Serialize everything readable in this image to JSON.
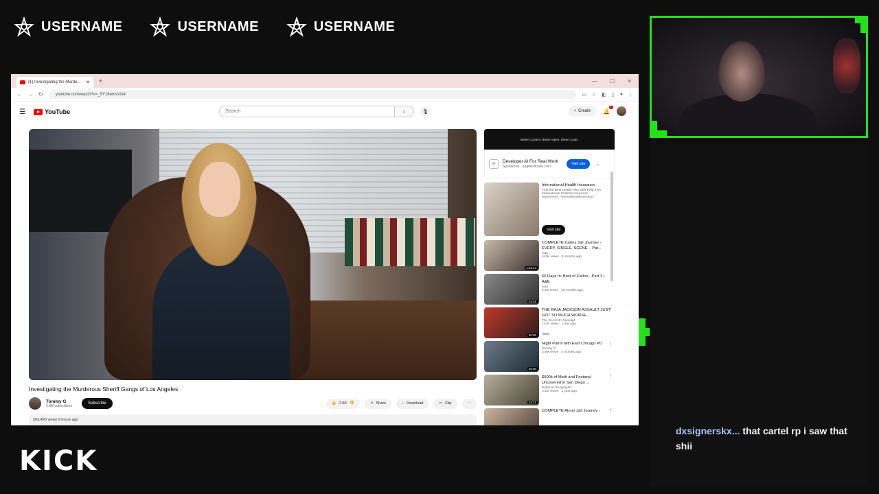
{
  "socials": [
    {
      "name": "USERNAME"
    },
    {
      "name": "USERNAME"
    },
    {
      "name": "USERNAME"
    }
  ],
  "browser": {
    "tab_title": "(1) Investigating the Murde...",
    "url": "youtube.com/watch?v=_9Y18emsVO4"
  },
  "youtube": {
    "logo": "YouTube",
    "search_placeholder": "Search",
    "create_label": "Create",
    "notifications": "1",
    "video": {
      "title": "Investigating the Murderous Sheriff Gangs of Los Angeles",
      "channel": "Tommy G",
      "subscribers": "2.8M subscribers",
      "subscribe_label": "Subscribe",
      "likes": "7.6K",
      "share_label": "Share",
      "download_label": "Download",
      "clip_label": "Clip",
      "views_time": "263,495 views  9 hours ago"
    },
    "ad": {
      "banner": "Better Content. Better Agent. Better Code.",
      "title": "Developer AI For Real Work",
      "sponsor": "Sponsored · augmentcode.com",
      "visit_label": "Visit site"
    },
    "recommendations": [
      {
        "title": "International Health Insurance",
        "channel": "Find the Best Health Plan with Help from International Citizens Insurance",
        "views": "Sponsored · internationalinsurance...",
        "duration": "",
        "visit": "Visit site",
        "thumb_colors": [
          "#d9d2c8",
          "#8a7a6a"
        ]
      },
      {
        "title": "COMPLETE Carlos Jail Journey - EVERY. SINGLE. SCENE. - Par...",
        "channel": "A&E",
        "views": "443K views · 5 months ago",
        "duration": "1:24:44",
        "thumb_colors": [
          "#c8b9a8",
          "#3d3331"
        ]
      },
      {
        "title": "60 Days In: Best of Carlos - Part 1 | A&E",
        "channel": "A&E",
        "views": "2.4M views · 10 months ago",
        "duration": "34:48",
        "thumb_colors": [
          "#8a8a8a",
          "#2f2f2f"
        ]
      },
      {
        "title": "THE RAJA JACKSON ASSAULT JUST GOT SO MUCH WORSE...",
        "channel": "The W.A.D.E. Concept",
        "views": "127K views · 1 day ago",
        "badge": "New",
        "duration": "35:00",
        "thumb_colors": [
          "#c0392b",
          "#2b1d1d"
        ]
      },
      {
        "title": "Night Patrol with East Chicago PD",
        "channel": "Tommy G",
        "views": "3.9M views · 3 months ago",
        "duration": "35:00",
        "thumb_colors": [
          "#6b7b88",
          "#1e2a33"
        ]
      },
      {
        "title": "$500k of Meth and Fentanyl Uncovered in San Diego ...",
        "channel": "National Geographic",
        "views": "3.1M views · 1 year ago",
        "duration": "44:21",
        "thumb_colors": [
          "#b5ae9c",
          "#4b4538"
        ]
      },
      {
        "title": "COMPLETE Abner Jail Journey -",
        "channel": "",
        "views": "",
        "duration": "",
        "thumb_colors": [
          "#c9b6a0",
          "#4a3b32"
        ]
      }
    ]
  },
  "chat": {
    "username": "dxsignerskx...",
    "message": "that cartel rp i saw that shii"
  },
  "brand": {
    "logo": "KICK",
    "accent": "#21e317"
  }
}
